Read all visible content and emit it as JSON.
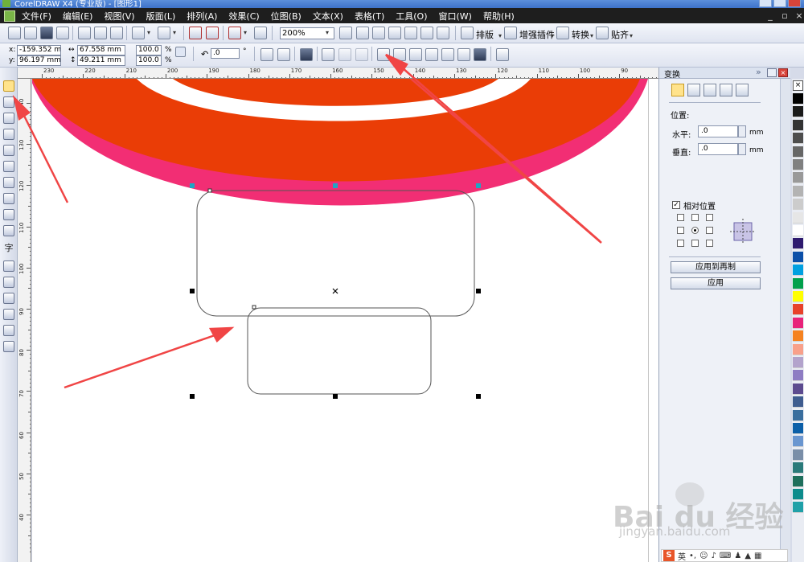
{
  "window": {
    "title": "CorelDRAW X4 (专业版) - [图形1]"
  },
  "menu": [
    "文件(F)",
    "编辑(E)",
    "视图(V)",
    "版面(L)",
    "排列(A)",
    "效果(C)",
    "位图(B)",
    "文本(X)",
    "表格(T)",
    "工具(O)",
    "窗口(W)",
    "帮助(H)"
  ],
  "toolbar": {
    "zoom_value": "200%",
    "layout_label": "排版",
    "plugin_label": "增强插件",
    "convert_label": "转换",
    "paste_label": "贴齐"
  },
  "property_bar": {
    "x_label": "x:",
    "x_value": "-159.352 mm",
    "y_label": "y:",
    "y_value": "96.197 mm",
    "width_value": "67.558 mm",
    "height_value": "49.211 mm",
    "scale_w": "100.0",
    "scale_h": "100.0",
    "percent": "%",
    "rotation": ".0",
    "degree": "°"
  },
  "ruler": {
    "top_labels": [
      "230",
      "220",
      "210",
      "200",
      "190",
      "180",
      "170",
      "160",
      "150",
      "140",
      "130",
      "120",
      "110",
      "100",
      "90"
    ],
    "left_labels": [
      "140",
      "130",
      "120",
      "110",
      "100",
      "90",
      "80",
      "70",
      "60",
      "50",
      "40"
    ],
    "unit": "毫米"
  },
  "docker": {
    "title": "变换",
    "position_heading": "位置:",
    "horizontal_label": "水平:",
    "horizontal_value": ".0",
    "vertical_label": "垂直:",
    "vertical_value": ".0",
    "unit": "mm",
    "relative_label": "相对位置",
    "relative_checked": true,
    "apply_copy_label": "应用到再制",
    "apply_label": "应用"
  },
  "palette_colors": [
    "#000000",
    "#1a1a1a",
    "#333333",
    "#4d4d4d",
    "#666666",
    "#808080",
    "#999999",
    "#b3b3b3",
    "#cccccc",
    "#e6e6e6",
    "#ffffff",
    "#2e1a6e",
    "#0b4fa8",
    "#00a0e0",
    "#00a04b",
    "#ffff00",
    "#e8412a",
    "#e8237a",
    "#f58220",
    "#f8a08a",
    "#b3a3cc",
    "#8e7cc3",
    "#5c4a8f",
    "#3e5c8f",
    "#3a6e9e",
    "#0b5fa8",
    "#6a96d0",
    "#7a8ea8",
    "#2a7a7a",
    "#1e6f5c",
    "#0d8c8c",
    "#1fa0a8"
  ],
  "shape_colors": {
    "outer_band": "#f22e74",
    "inner_band": "#ea3d06",
    "node_handle": "#1fa5c4"
  },
  "ime": {
    "mode": "英"
  },
  "watermark": {
    "logo": "Bai du 经验",
    "url": "jingyan.baidu.com"
  }
}
